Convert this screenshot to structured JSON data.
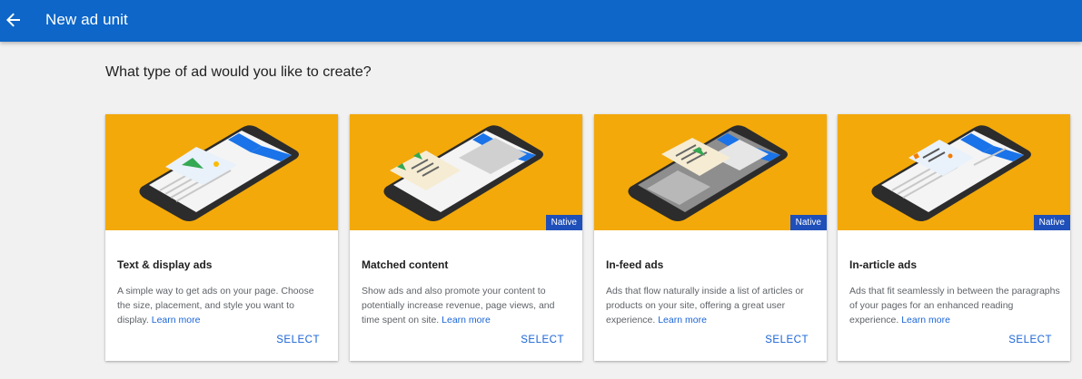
{
  "header": {
    "title": "New ad unit",
    "back_icon": "arrow-back-icon"
  },
  "main": {
    "heading": "What type of ad would you like to create?"
  },
  "colors": {
    "topbar": "#0d66c8",
    "card_image_bg": "#f3a90a",
    "native_badge": "#1f4fb9",
    "link": "#1a64d6"
  },
  "cards": [
    {
      "title": "Text & display ads",
      "description": "A simple way to get ads on your page. Choose the size, placement, and style you want to display.",
      "learn_more": "Learn more",
      "select": "SELECT",
      "badge": ""
    },
    {
      "title": "Matched content",
      "description": "Show ads and also promote your content to potentially increase revenue, page views, and time spent on site.",
      "learn_more": "Learn more",
      "select": "SELECT",
      "badge": "Native"
    },
    {
      "title": "In-feed ads",
      "description": "Ads that flow naturally inside a list of articles or products on your site, offering a great user experience.",
      "learn_more": "Learn more",
      "select": "SELECT",
      "badge": "Native"
    },
    {
      "title": "In-article ads",
      "description": "Ads that fit seamlessly in between the paragraphs of your pages for an enhanced reading experience.",
      "learn_more": "Learn more",
      "select": "SELECT",
      "badge": "Native"
    }
  ]
}
